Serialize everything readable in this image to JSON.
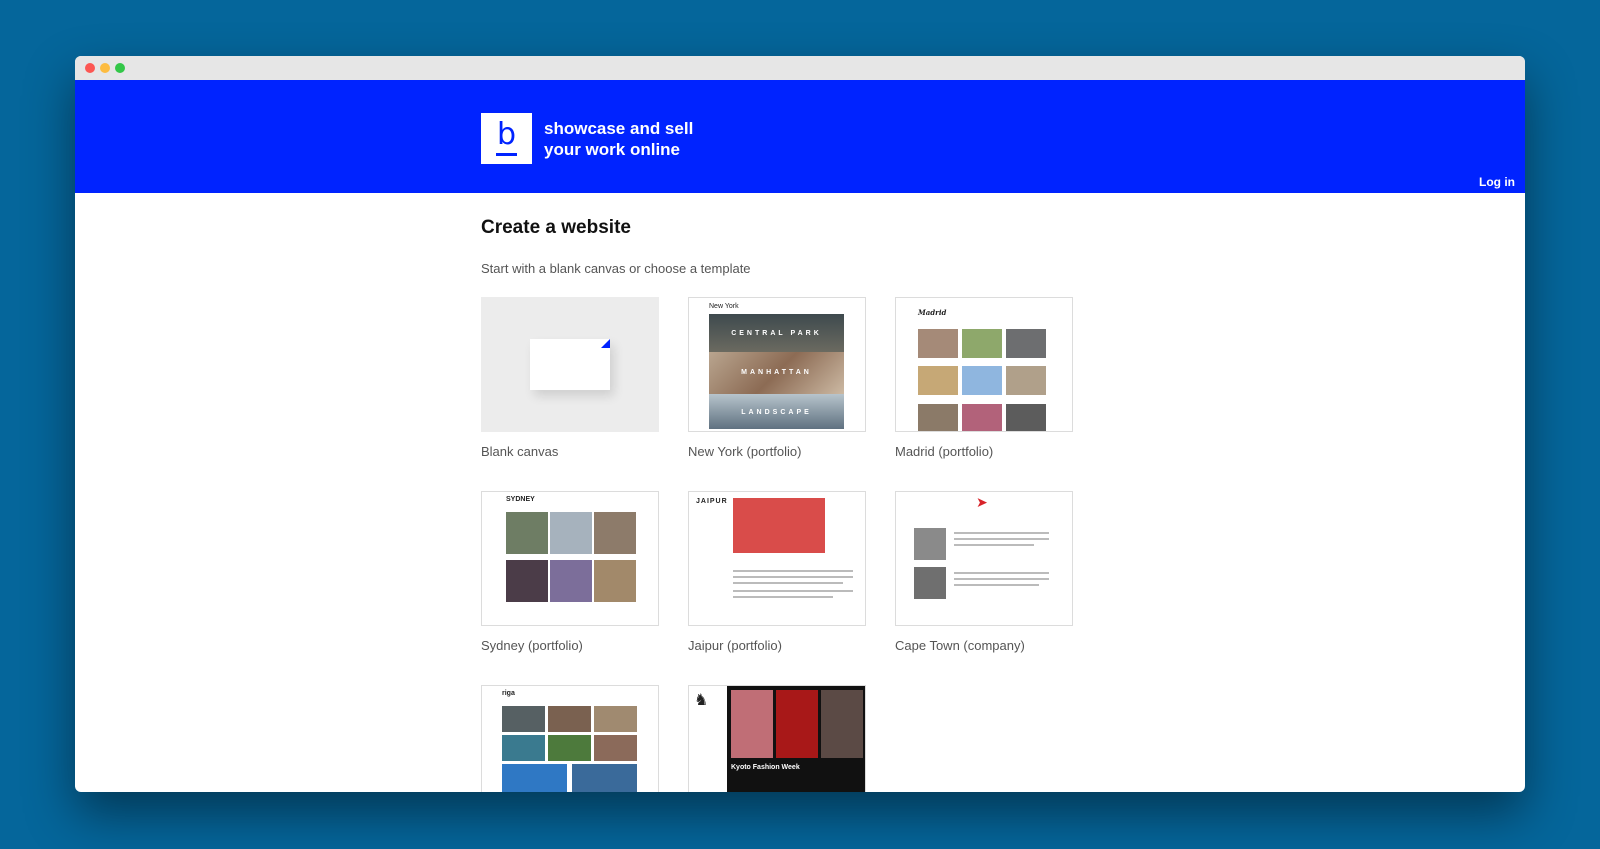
{
  "header": {
    "tagline_line1": "showcase and sell",
    "tagline_line2": "your work online",
    "logo_letter": "b",
    "login_label": "Log in",
    "brand_color": "#0023ff"
  },
  "main": {
    "title": "Create a website",
    "subtitle": "Start with a blank canvas or choose a template"
  },
  "templates": [
    {
      "label": "Blank canvas"
    },
    {
      "label": "New York (portfolio)",
      "preview": {
        "title": "New York",
        "bands": [
          "CENTRAL PARK",
          "MANHATTAN",
          "LANDSCAPE"
        ]
      }
    },
    {
      "label": "Madrid (portfolio)",
      "preview": {
        "title": "Madrid"
      }
    },
    {
      "label": "Sydney (portfolio)",
      "preview": {
        "title": "SYDNEY"
      }
    },
    {
      "label": "Jaipur (portfolio)",
      "preview": {
        "title": "JAIPUR"
      }
    },
    {
      "label": "Cape Town (company)"
    },
    {
      "label": "",
      "preview": {
        "title": "riga"
      }
    },
    {
      "label": "",
      "preview": {
        "caption": "Kyoto Fashion Week"
      }
    }
  ],
  "colors": {
    "background": "#05669b",
    "header": "#0023ff"
  }
}
